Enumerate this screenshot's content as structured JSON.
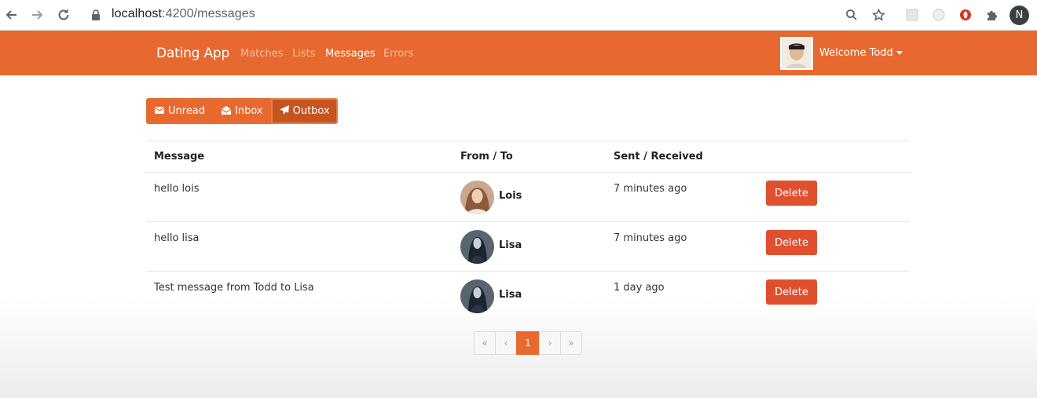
{
  "browser": {
    "url_host": "localhost",
    "url_path": ":4200/messages",
    "profile_initial": "N"
  },
  "navbar": {
    "brand": "Dating App",
    "links": [
      {
        "label": "Matches",
        "active": false
      },
      {
        "label": "Lists",
        "active": false
      },
      {
        "label": "Messages",
        "active": true
      },
      {
        "label": "Errors",
        "active": false
      }
    ],
    "welcome": "Welcome Todd"
  },
  "tabs": [
    {
      "label": "Unread",
      "icon": "envelope-icon",
      "active": false
    },
    {
      "label": "Inbox",
      "icon": "envelope-open-icon",
      "active": false
    },
    {
      "label": "Outbox",
      "icon": "paper-plane-icon",
      "active": true
    }
  ],
  "table": {
    "headers": [
      "Message",
      "From / To",
      "Sent / Received"
    ],
    "rows": [
      {
        "message": "hello lois",
        "name": "Lois",
        "sent": "7 minutes ago",
        "action": "Delete"
      },
      {
        "message": "hello lisa",
        "name": "Lisa",
        "sent": "7 minutes ago",
        "action": "Delete"
      },
      {
        "message": "Test message from Todd to Lisa",
        "name": "Lisa",
        "sent": "1 day ago",
        "action": "Delete"
      }
    ]
  },
  "pagination": {
    "first": "«",
    "prev": "‹",
    "current": "1",
    "next": "›",
    "last": "»"
  },
  "colors": {
    "primary": "#e8692f",
    "danger": "#e04f2e"
  }
}
